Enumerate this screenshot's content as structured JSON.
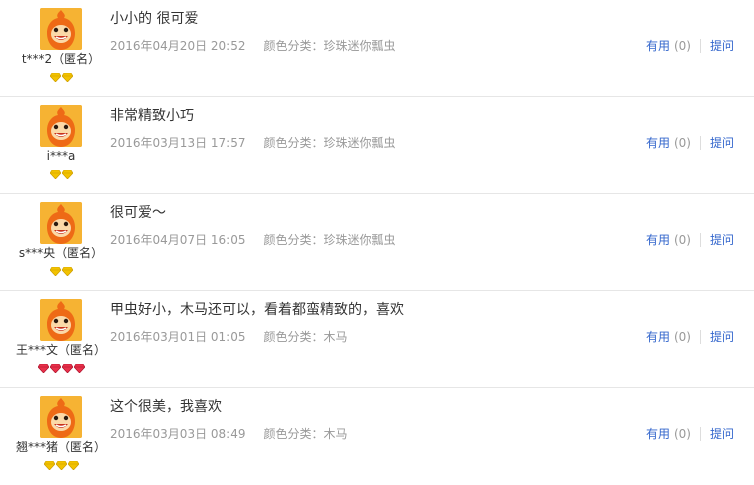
{
  "reviews": [
    {
      "user": "t***2（匿名）",
      "badge_type": "gold",
      "badge_count": 2,
      "content": "小小的 很可爱",
      "date": "2016年04月20日 20:52",
      "sku": "颜色分类：珍珠迷你瓢虫",
      "useful_label": "有用",
      "useful_count": "(0)",
      "ask_label": "提问"
    },
    {
      "user": "i***a",
      "badge_type": "gold",
      "badge_count": 2,
      "content": "非常精致小巧",
      "date": "2016年03月13日 17:57",
      "sku": "颜色分类：珍珠迷你瓢虫",
      "useful_label": "有用",
      "useful_count": "(0)",
      "ask_label": "提问"
    },
    {
      "user": "s***央（匿名）",
      "badge_type": "gold",
      "badge_count": 2,
      "content": "很可爱～",
      "date": "2016年04月07日 16:05",
      "sku": "颜色分类：珍珠迷你瓢虫",
      "useful_label": "有用",
      "useful_count": "(0)",
      "ask_label": "提问"
    },
    {
      "user": "王***文（匿名）",
      "badge_type": "red",
      "badge_count": 4,
      "content": "甲虫好小，木马还可以，看着都蛮精致的，喜欢",
      "date": "2016年03月01日 01:05",
      "sku": "颜色分类：木马",
      "useful_label": "有用",
      "useful_count": "(0)",
      "ask_label": "提问"
    },
    {
      "user": "翘***猪（匿名）",
      "badge_type": "gold",
      "badge_count": 3,
      "content": "这个很美，我喜欢",
      "date": "2016年03月03日 08:49",
      "sku": "颜色分类：木马",
      "useful_label": "有用",
      "useful_count": "(0)",
      "ask_label": "提问"
    }
  ],
  "colors": {
    "link": "#3366cc",
    "meta": "#999999",
    "divider": "#e6e6e6",
    "badge_gold": "#f2c200",
    "badge_red": "#e8304a",
    "avatar_bg": "#f6b333"
  }
}
